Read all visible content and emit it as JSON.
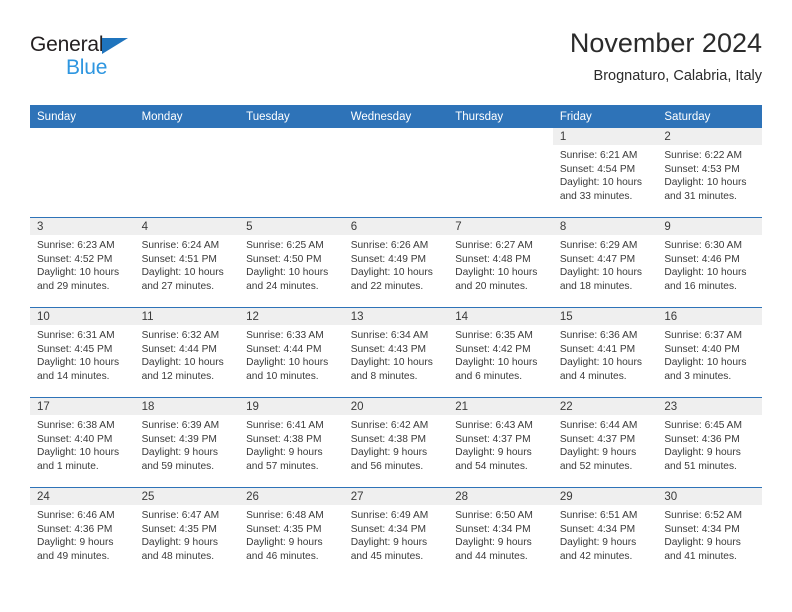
{
  "brand": {
    "name_part1": "General",
    "name_part2": "Blue",
    "accent_color": "#2e73b8",
    "logo_triangle_color": "#1f74bd",
    "logo_blue_text_color": "#2e96e0"
  },
  "header": {
    "title": "November 2024",
    "subtitle": "Brognaturo, Calabria, Italy"
  },
  "weekday_headers": [
    "Sunday",
    "Monday",
    "Tuesday",
    "Wednesday",
    "Thursday",
    "Friday",
    "Saturday"
  ],
  "weeks": [
    [
      {
        "day": "",
        "sunrise": "",
        "sunset": "",
        "daylight_line1": "",
        "daylight_line2": "",
        "blank": true
      },
      {
        "day": "",
        "sunrise": "",
        "sunset": "",
        "daylight_line1": "",
        "daylight_line2": "",
        "blank": true
      },
      {
        "day": "",
        "sunrise": "",
        "sunset": "",
        "daylight_line1": "",
        "daylight_line2": "",
        "blank": true
      },
      {
        "day": "",
        "sunrise": "",
        "sunset": "",
        "daylight_line1": "",
        "daylight_line2": "",
        "blank": true
      },
      {
        "day": "",
        "sunrise": "",
        "sunset": "",
        "daylight_line1": "",
        "daylight_line2": "",
        "blank": true
      },
      {
        "day": "1",
        "sunrise": "Sunrise: 6:21 AM",
        "sunset": "Sunset: 4:54 PM",
        "daylight_line1": "Daylight: 10 hours",
        "daylight_line2": "and 33 minutes."
      },
      {
        "day": "2",
        "sunrise": "Sunrise: 6:22 AM",
        "sunset": "Sunset: 4:53 PM",
        "daylight_line1": "Daylight: 10 hours",
        "daylight_line2": "and 31 minutes."
      }
    ],
    [
      {
        "day": "3",
        "sunrise": "Sunrise: 6:23 AM",
        "sunset": "Sunset: 4:52 PM",
        "daylight_line1": "Daylight: 10 hours",
        "daylight_line2": "and 29 minutes."
      },
      {
        "day": "4",
        "sunrise": "Sunrise: 6:24 AM",
        "sunset": "Sunset: 4:51 PM",
        "daylight_line1": "Daylight: 10 hours",
        "daylight_line2": "and 27 minutes."
      },
      {
        "day": "5",
        "sunrise": "Sunrise: 6:25 AM",
        "sunset": "Sunset: 4:50 PM",
        "daylight_line1": "Daylight: 10 hours",
        "daylight_line2": "and 24 minutes."
      },
      {
        "day": "6",
        "sunrise": "Sunrise: 6:26 AM",
        "sunset": "Sunset: 4:49 PM",
        "daylight_line1": "Daylight: 10 hours",
        "daylight_line2": "and 22 minutes."
      },
      {
        "day": "7",
        "sunrise": "Sunrise: 6:27 AM",
        "sunset": "Sunset: 4:48 PM",
        "daylight_line1": "Daylight: 10 hours",
        "daylight_line2": "and 20 minutes."
      },
      {
        "day": "8",
        "sunrise": "Sunrise: 6:29 AM",
        "sunset": "Sunset: 4:47 PM",
        "daylight_line1": "Daylight: 10 hours",
        "daylight_line2": "and 18 minutes."
      },
      {
        "day": "9",
        "sunrise": "Sunrise: 6:30 AM",
        "sunset": "Sunset: 4:46 PM",
        "daylight_line1": "Daylight: 10 hours",
        "daylight_line2": "and 16 minutes."
      }
    ],
    [
      {
        "day": "10",
        "sunrise": "Sunrise: 6:31 AM",
        "sunset": "Sunset: 4:45 PM",
        "daylight_line1": "Daylight: 10 hours",
        "daylight_line2": "and 14 minutes."
      },
      {
        "day": "11",
        "sunrise": "Sunrise: 6:32 AM",
        "sunset": "Sunset: 4:44 PM",
        "daylight_line1": "Daylight: 10 hours",
        "daylight_line2": "and 12 minutes."
      },
      {
        "day": "12",
        "sunrise": "Sunrise: 6:33 AM",
        "sunset": "Sunset: 4:44 PM",
        "daylight_line1": "Daylight: 10 hours",
        "daylight_line2": "and 10 minutes."
      },
      {
        "day": "13",
        "sunrise": "Sunrise: 6:34 AM",
        "sunset": "Sunset: 4:43 PM",
        "daylight_line1": "Daylight: 10 hours",
        "daylight_line2": "and 8 minutes."
      },
      {
        "day": "14",
        "sunrise": "Sunrise: 6:35 AM",
        "sunset": "Sunset: 4:42 PM",
        "daylight_line1": "Daylight: 10 hours",
        "daylight_line2": "and 6 minutes."
      },
      {
        "day": "15",
        "sunrise": "Sunrise: 6:36 AM",
        "sunset": "Sunset: 4:41 PM",
        "daylight_line1": "Daylight: 10 hours",
        "daylight_line2": "and 4 minutes."
      },
      {
        "day": "16",
        "sunrise": "Sunrise: 6:37 AM",
        "sunset": "Sunset: 4:40 PM",
        "daylight_line1": "Daylight: 10 hours",
        "daylight_line2": "and 3 minutes."
      }
    ],
    [
      {
        "day": "17",
        "sunrise": "Sunrise: 6:38 AM",
        "sunset": "Sunset: 4:40 PM",
        "daylight_line1": "Daylight: 10 hours",
        "daylight_line2": "and 1 minute."
      },
      {
        "day": "18",
        "sunrise": "Sunrise: 6:39 AM",
        "sunset": "Sunset: 4:39 PM",
        "daylight_line1": "Daylight: 9 hours",
        "daylight_line2": "and 59 minutes."
      },
      {
        "day": "19",
        "sunrise": "Sunrise: 6:41 AM",
        "sunset": "Sunset: 4:38 PM",
        "daylight_line1": "Daylight: 9 hours",
        "daylight_line2": "and 57 minutes."
      },
      {
        "day": "20",
        "sunrise": "Sunrise: 6:42 AM",
        "sunset": "Sunset: 4:38 PM",
        "daylight_line1": "Daylight: 9 hours",
        "daylight_line2": "and 56 minutes."
      },
      {
        "day": "21",
        "sunrise": "Sunrise: 6:43 AM",
        "sunset": "Sunset: 4:37 PM",
        "daylight_line1": "Daylight: 9 hours",
        "daylight_line2": "and 54 minutes."
      },
      {
        "day": "22",
        "sunrise": "Sunrise: 6:44 AM",
        "sunset": "Sunset: 4:37 PM",
        "daylight_line1": "Daylight: 9 hours",
        "daylight_line2": "and 52 minutes."
      },
      {
        "day": "23",
        "sunrise": "Sunrise: 6:45 AM",
        "sunset": "Sunset: 4:36 PM",
        "daylight_line1": "Daylight: 9 hours",
        "daylight_line2": "and 51 minutes."
      }
    ],
    [
      {
        "day": "24",
        "sunrise": "Sunrise: 6:46 AM",
        "sunset": "Sunset: 4:36 PM",
        "daylight_line1": "Daylight: 9 hours",
        "daylight_line2": "and 49 minutes."
      },
      {
        "day": "25",
        "sunrise": "Sunrise: 6:47 AM",
        "sunset": "Sunset: 4:35 PM",
        "daylight_line1": "Daylight: 9 hours",
        "daylight_line2": "and 48 minutes."
      },
      {
        "day": "26",
        "sunrise": "Sunrise: 6:48 AM",
        "sunset": "Sunset: 4:35 PM",
        "daylight_line1": "Daylight: 9 hours",
        "daylight_line2": "and 46 minutes."
      },
      {
        "day": "27",
        "sunrise": "Sunrise: 6:49 AM",
        "sunset": "Sunset: 4:34 PM",
        "daylight_line1": "Daylight: 9 hours",
        "daylight_line2": "and 45 minutes."
      },
      {
        "day": "28",
        "sunrise": "Sunrise: 6:50 AM",
        "sunset": "Sunset: 4:34 PM",
        "daylight_line1": "Daylight: 9 hours",
        "daylight_line2": "and 44 minutes."
      },
      {
        "day": "29",
        "sunrise": "Sunrise: 6:51 AM",
        "sunset": "Sunset: 4:34 PM",
        "daylight_line1": "Daylight: 9 hours",
        "daylight_line2": "and 42 minutes."
      },
      {
        "day": "30",
        "sunrise": "Sunrise: 6:52 AM",
        "sunset": "Sunset: 4:34 PM",
        "daylight_line1": "Daylight: 9 hours",
        "daylight_line2": "and 41 minutes."
      }
    ]
  ]
}
